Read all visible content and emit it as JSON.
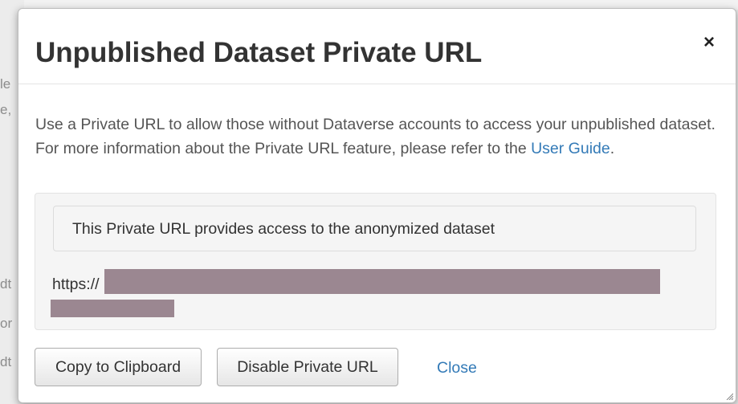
{
  "background": {
    "text_fragments": [
      "le",
      "e,",
      "dt",
      "or",
      "dt"
    ]
  },
  "modal": {
    "title": "Unpublished Dataset Private URL",
    "close_glyph": "×",
    "description_prefix": "Use a Private URL to allow those without Dataverse accounts to access your unpublished dataset. For more information about the Private URL feature, please refer to the ",
    "description_link": "User Guide",
    "description_suffix": ".",
    "info_text": "This Private URL provides access to the anonymized dataset",
    "url_visible": "https://",
    "buttons": {
      "copy": "Copy to Clipboard",
      "disable": "Disable Private URL",
      "close": "Close"
    }
  },
  "colors": {
    "link": "#337ab7",
    "redaction": "#9b8791"
  }
}
